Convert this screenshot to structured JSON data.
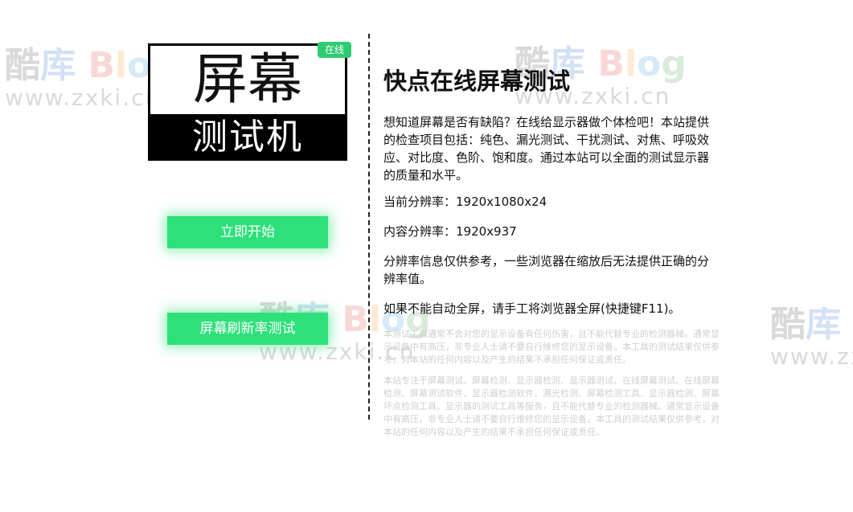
{
  "watermark": {
    "logo_chars": [
      "酷",
      "库",
      "B",
      "l",
      "o",
      "g"
    ],
    "url": "www.zxki.cn"
  },
  "logo": {
    "top_text": "屏幕",
    "bottom_text": "测试机",
    "badge": "在线"
  },
  "buttons": {
    "start": "立即开始",
    "refresh_rate": "屏幕刷新率测试"
  },
  "main": {
    "title": "快点在线屏幕测试",
    "intro": "想知道屏幕是否有缺陷？在线给显示器做个体检吧！本站提供的检查项目包括：纯色、漏光测试、干扰测试、对焦、呼吸效应、对比度、色阶、饱和度。通过本站可以全面的测试显示器的质量和水平。",
    "current_resolution": "当前分辨率：1920x1080x24",
    "content_resolution": "内容分辨率：1920x937",
    "resolution_note": "分辨率信息仅供参考，一些浏览器在缩放后无法提供正确的分辨率值。",
    "fullscreen_note": "如果不能自动全屏，请手工将浏览器全屏(快捷键F11)。",
    "disclaimer": "本测试工具通常不会对您的显示设备有任何伤害，且不能代替专业的检测器械。通常显示设备中有高压，非专业人士请不要自行维修您的显示设备。本工具的测试结果仅供参考，对本站的任何内容以及产生的结果不承担任何保证或责任。",
    "keywords": "本站专注于屏幕测试、屏幕检测、显示器检测、显示器测试、在线屏幕测试、在线屏幕检测、屏幕测试软件、显示器检测软件、漏光检测、屏幕检测工具、显示器检测、屏幕坏点检测工具、显示器的测试工具等服务，且不能代替专业的检测器械。通常显示设备中有高压，非专业人士请不要自行维修您的显示设备。本工具的测试结果仅供参考，对本站的任何内容以及产生的结果不承担任何保证或责任。"
  }
}
